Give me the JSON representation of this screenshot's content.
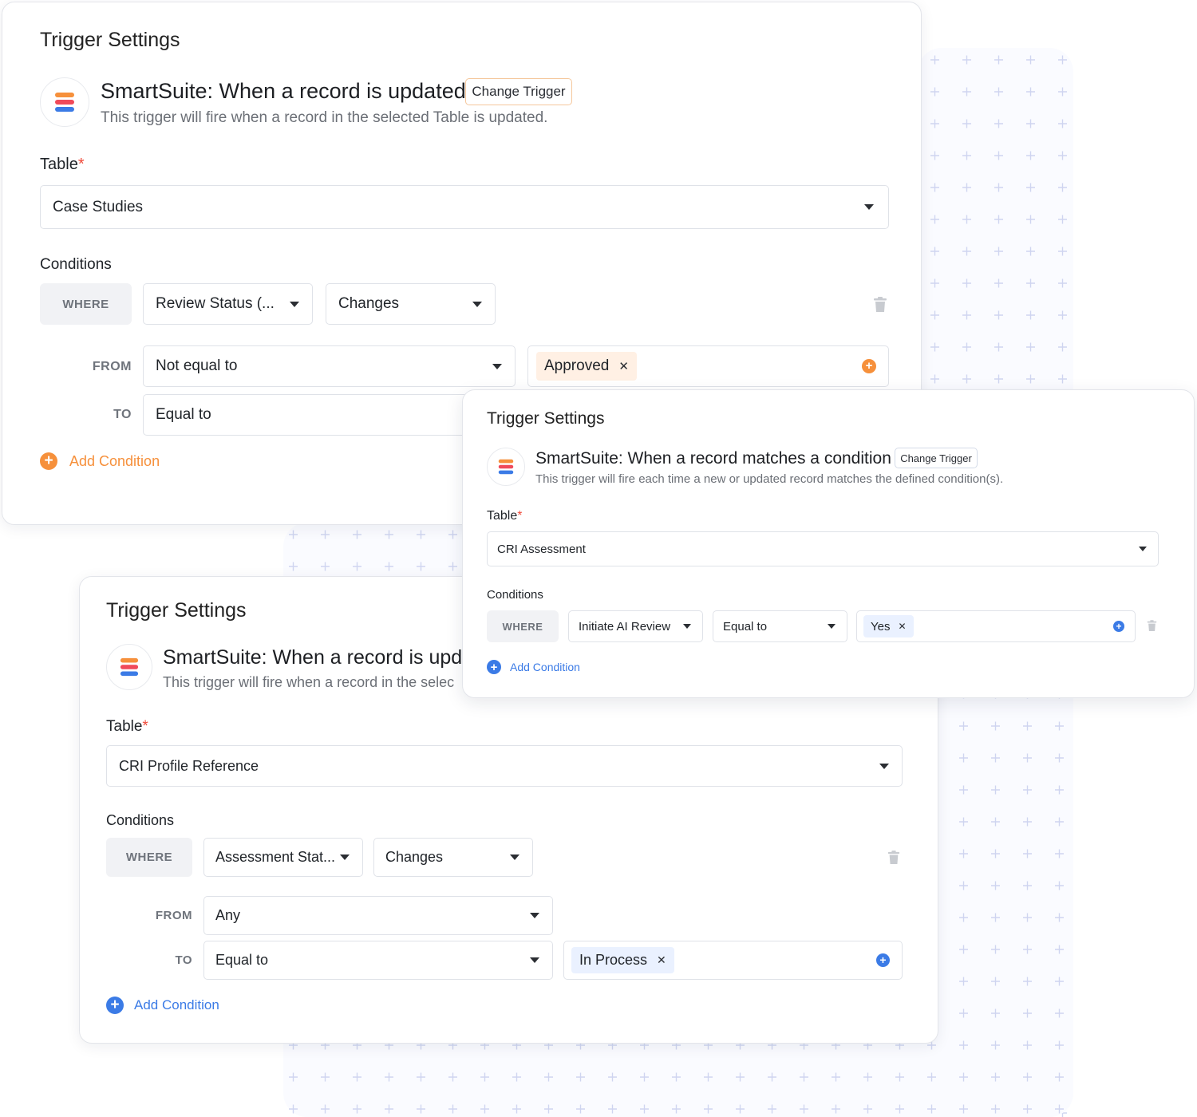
{
  "theme": {
    "orange": "#f6903b",
    "blue": "#3b7be6",
    "chip_orange_bg": "#fff0e4",
    "chip_blue_bg": "#eaf1ff"
  },
  "card1": {
    "title": "Trigger Settings",
    "headline": "SmartSuite: When a record is updated",
    "change_trigger": "Change Trigger",
    "subline": "This trigger will fire when a record in the selected Table is updated.",
    "table_label": "Table",
    "required_mark": "*",
    "table_value": "Case Studies",
    "conditions_label": "Conditions",
    "where_label": "WHERE",
    "field_value": "Review Status (...",
    "operator_value": "Changes",
    "from_label": "FROM",
    "from_value": "Not equal to",
    "from_chip": "Approved",
    "to_label": "TO",
    "to_value": "Equal to",
    "add_condition": "Add Condition",
    "icons": {
      "logo": "smartsuite-logo-icon",
      "trash": "trash-icon",
      "add": "plus-circle-icon",
      "remove": "close-icon",
      "caret": "chevron-down-icon"
    }
  },
  "card2": {
    "title": "Trigger Settings",
    "headline": "SmartSuite: When a record matches a condition",
    "change_trigger": "Change Trigger",
    "subline": "This trigger will fire each time a new or updated record matches the defined condition(s).",
    "table_label": "Table",
    "required_mark": "*",
    "table_value": "CRI Assessment",
    "conditions_label": "Conditions",
    "where_label": "WHERE",
    "field_value": "Initiate AI Review",
    "operator_value": "Equal to",
    "value_chip": "Yes",
    "add_condition": "Add Condition"
  },
  "card3": {
    "title": "Trigger Settings",
    "headline": "SmartSuite: When a record is upda",
    "subline": "This trigger will fire when a record in the selec",
    "table_label": "Table",
    "required_mark": "*",
    "table_value": "CRI Profile Reference",
    "conditions_label": "Conditions",
    "where_label": "WHERE",
    "field_value": "Assessment Stat...",
    "operator_value": "Changes",
    "from_label": "FROM",
    "from_value": "Any",
    "to_label": "TO",
    "to_value": "Equal to",
    "to_chip": "In Process",
    "add_condition": "Add Condition"
  },
  "glyphs": {
    "close": "✕",
    "plus": "+"
  }
}
